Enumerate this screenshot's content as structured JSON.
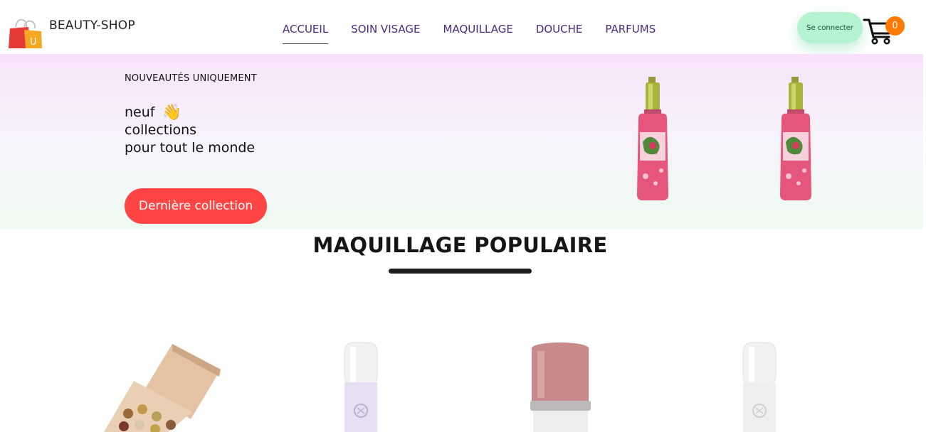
{
  "header": {
    "brand": "BEAUTY-SHOP",
    "logo_letter": "U",
    "nav": [
      {
        "label": "ACCUEIL",
        "active": true
      },
      {
        "label": "SOIN VISAGE",
        "active": false
      },
      {
        "label": "MAQUILLAGE",
        "active": false
      },
      {
        "label": "DOUCHE",
        "active": false
      },
      {
        "label": "PARFUMS",
        "active": false
      }
    ],
    "login_label": "Se connecter",
    "cart_count": "0",
    "cart_icon": "shopping-cart-icon"
  },
  "hero": {
    "subtitle": "NOUVEAUTÉS UNIQUEMENT",
    "title_line1": "neuf",
    "title_line2": "collections",
    "title_line3": "pour tout le monde",
    "wave_emoji": "👋",
    "cta_label": "Dernière collection",
    "product_icons": [
      "perfume-bottle-icon",
      "perfume-bottle-icon"
    ]
  },
  "popular": {
    "title": "MAQUILLAGE POPULAIRE",
    "products": [
      "eyeshadow-palette",
      "lip-gloss-tube",
      "lipstick-stick",
      "lip-gloss-tube"
    ]
  },
  "colors": {
    "nav_text": "#4b2a7a",
    "cta": "#ff4444",
    "login_bg": "#b5f2cf",
    "badge": "#ff7a00"
  }
}
